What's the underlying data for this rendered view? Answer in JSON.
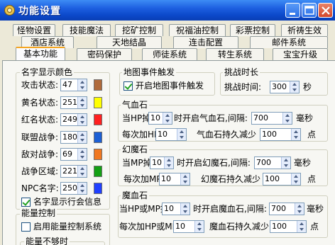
{
  "window": {
    "title": "功能设置",
    "colors": {
      "titlebar": "#0b48c9",
      "close_button": "#d4482a",
      "tab_highlight": "#f5a623"
    }
  },
  "tabs": [
    {
      "label": "怪物设置"
    },
    {
      "label": "技能魔法"
    },
    {
      "label": "挖矿控制"
    },
    {
      "label": "祝福油控制"
    },
    {
      "label": "彩票控制"
    },
    {
      "label": "祈祷生效"
    },
    {
      "label": "酒店系统"
    },
    {
      "label": "天地结晶"
    },
    {
      "label": "连击配置"
    },
    {
      "label": "邮件系统"
    },
    {
      "label": "基本功能",
      "active": true
    },
    {
      "label": "密码保护"
    },
    {
      "label": "师徒系统"
    },
    {
      "label": "转生系统"
    },
    {
      "label": "宝宝升级"
    }
  ],
  "name_color": {
    "title": "名字显示颜色",
    "rows": [
      {
        "label": "攻击状态:",
        "value": "47",
        "color": "#b06a3a"
      },
      {
        "label": "黄名状态:",
        "value": "251",
        "color": "#ffff00"
      },
      {
        "label": "红名状态:",
        "value": "249",
        "color": "#ff2020"
      },
      {
        "label": "联盟战争:",
        "value": "180",
        "color": "#1c5fd4"
      },
      {
        "label": "敌对战争:",
        "value": "69",
        "color": "#f07820"
      },
      {
        "label": "战争区域:",
        "value": "221",
        "color": "#14a014"
      },
      {
        "label": "NPC名字:",
        "value": "250",
        "color": "#2040ff"
      }
    ],
    "show_line_info": "名字显示行会信息"
  },
  "energy": {
    "title": "能量控制",
    "enable_label": "启用能量控制系统",
    "sub_title": "能量不够时"
  },
  "map_event": {
    "title": "地图事件触发",
    "enable_label": "开启地图事件触发"
  },
  "challenge": {
    "title": "挑战时长",
    "time_label": "挑战时间:",
    "time_value": "300",
    "unit": "秒"
  },
  "hp_stone": {
    "title": "气血石",
    "line1_prefix": "当HP掉",
    "threshold": "10",
    "line1_mid": "时开启气血石,间隔:",
    "interval": "700",
    "interval_unit": "毫秒",
    "line2_prefix": "每次加HP",
    "add": "10",
    "line2_mid": "气血石持久减少",
    "reduce": "100",
    "reduce_unit": "点"
  },
  "mp_stone": {
    "title": "幻魔石",
    "line1_prefix": "当MP掉",
    "threshold": "10",
    "line1_mid": "时开启幻魔石,间隔:",
    "interval": "700",
    "interval_unit": "毫秒",
    "line2_prefix": "每次加MP",
    "add": "10",
    "line2_mid": "幻魔石持久减少",
    "reduce": "100",
    "reduce_unit": "点"
  },
  "hpmp_stone": {
    "title": "魔血石",
    "line1_prefix": "当HP或MP掉",
    "threshold": "10",
    "line1_mid": "时开启魔血石,间隔:",
    "interval": "700",
    "interval_unit": "毫秒",
    "line2_prefix": "每次加HP或MP",
    "add": "10",
    "line2_mid": "魔血石持久减少",
    "reduce": "100",
    "reduce_unit": "点"
  }
}
